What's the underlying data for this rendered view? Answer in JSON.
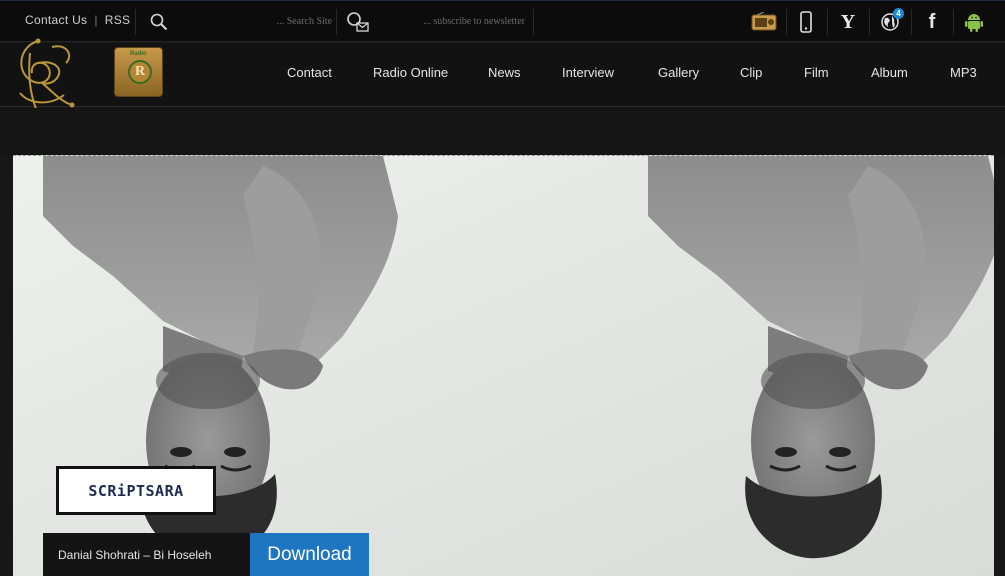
{
  "topbar": {
    "links": {
      "contact_us": "Contact Us",
      "separator": "|",
      "rss": "RSS"
    },
    "search_placeholder": "... Search Site",
    "newsletter_placeholder": "... subscribe to newsletter",
    "social_icons": [
      "radio-icon",
      "mobile-icon",
      "yahoo-icon",
      "globe-icon",
      "facebook-icon",
      "android-icon"
    ],
    "yahoo_letter": "Y",
    "facebook_letter": "f",
    "globe_badge": "4"
  },
  "header": {
    "logo_letters": "RS",
    "radio_logo_caption": "Radio",
    "radio_logo_letter": "R",
    "nav": [
      "Contact",
      "Radio Online",
      "News",
      "Interview",
      "Gallery",
      "Clip",
      "Film",
      "Album",
      "MP3"
    ]
  },
  "hero": {
    "watermark": "SCRiPTSARA",
    "song_title": "Danial Shohrati – Bi Hoseleh",
    "download_label": "Download"
  },
  "colors": {
    "background": "#171717",
    "topbar": "#0c0c0c",
    "download_button": "#1e75c0",
    "logo_gold": "#b8963a"
  }
}
